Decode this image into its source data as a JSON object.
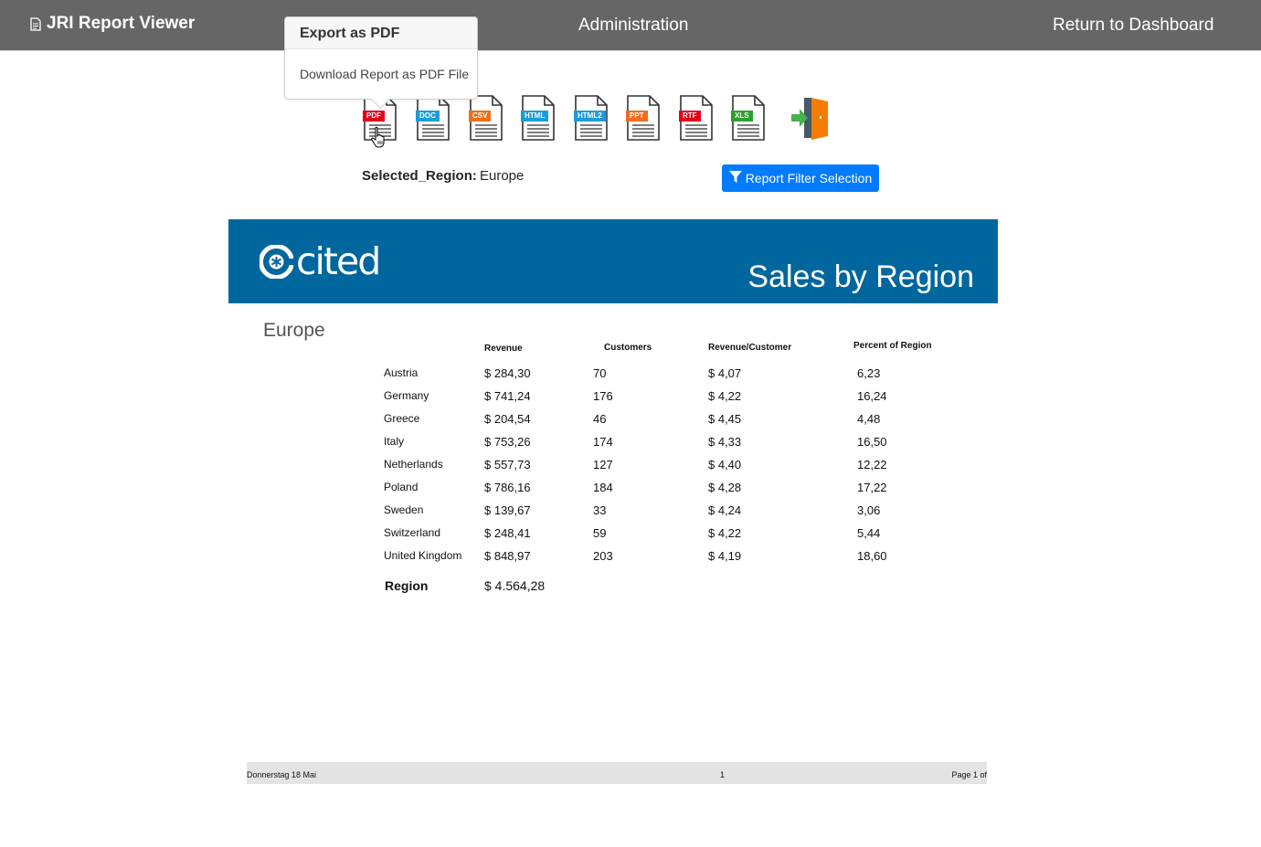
{
  "navbar": {
    "brand": "JRI Report Viewer",
    "admin": "Administration",
    "return": "Return to Dashboard"
  },
  "popover": {
    "title": "Export as PDF",
    "body": "Download Report as PDF File"
  },
  "export_icons": [
    {
      "label": "PDF",
      "color": "#e2001a"
    },
    {
      "label": "DOC",
      "color": "#1e9bd7"
    },
    {
      "label": "CSV",
      "color": "#e8711a"
    },
    {
      "label": "HTML",
      "color": "#1e9bd7"
    },
    {
      "label": "HTML2",
      "color": "#1e9bd7"
    },
    {
      "label": "PPT",
      "color": "#f06d1e"
    },
    {
      "label": "RTF",
      "color": "#e2001a"
    },
    {
      "label": "XLS",
      "color": "#2ca02c"
    }
  ],
  "selection": {
    "label": "Selected_Region:",
    "value": "Europe",
    "filter_button": "Report Filter Selection"
  },
  "report": {
    "logo_text": "cited",
    "title": "Sales by Region",
    "region": "Europe",
    "columns": {
      "revenue": "Revenue",
      "customers": "Customers",
      "rev_per_customer": "Revenue/Customer",
      "percent": "Percent of Region"
    },
    "rows": [
      {
        "country": "Austria",
        "revenue": "$ 284,30",
        "customers": "70",
        "rpc": "$ 4,07",
        "pct": "6,23"
      },
      {
        "country": "Germany",
        "revenue": "$ 741,24",
        "customers": "176",
        "rpc": "$ 4,22",
        "pct": "16,24"
      },
      {
        "country": "Greece",
        "revenue": "$ 204,54",
        "customers": "46",
        "rpc": "$ 4,45",
        "pct": "4,48"
      },
      {
        "country": "Italy",
        "revenue": "$ 753,26",
        "customers": "174",
        "rpc": "$ 4,33",
        "pct": "16,50"
      },
      {
        "country": "Netherlands",
        "revenue": "$ 557,73",
        "customers": "127",
        "rpc": "$ 4,40",
        "pct": "12,22"
      },
      {
        "country": "Poland",
        "revenue": "$ 786,16",
        "customers": "184",
        "rpc": "$ 4,28",
        "pct": "17,22"
      },
      {
        "country": "Sweden",
        "revenue": "$ 139,67",
        "customers": "33",
        "rpc": "$ 4,24",
        "pct": "3,06"
      },
      {
        "country": "Switzerland",
        "revenue": "$ 248,41",
        "customers": "59",
        "rpc": "$ 4,22",
        "pct": "5,44"
      },
      {
        "country": "United Kingdom",
        "revenue": "$ 848,97",
        "customers": "203",
        "rpc": "$ 4,19",
        "pct": "18,60"
      }
    ],
    "total_label": "Region",
    "total_value": "$ 4.564,28",
    "footer": {
      "date": "Donnerstag 18 Mai",
      "page_number": "1",
      "page_of": "Page 1 of"
    }
  }
}
